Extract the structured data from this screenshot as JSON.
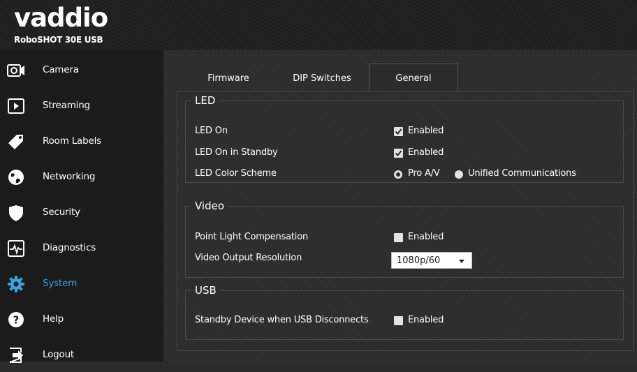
{
  "header": {
    "logo_text": "vaddio",
    "model": "RoboSHOT 30E USB"
  },
  "sidebar": {
    "items": [
      {
        "label": "Camera",
        "icon": "camera-icon"
      },
      {
        "label": "Streaming",
        "icon": "play-icon"
      },
      {
        "label": "Room Labels",
        "icon": "tag-icon"
      },
      {
        "label": "Networking",
        "icon": "globe-icon"
      },
      {
        "label": "Security",
        "icon": "shield-icon"
      },
      {
        "label": "Diagnostics",
        "icon": "pulse-icon"
      },
      {
        "label": "System",
        "icon": "gear-icon",
        "active": true
      },
      {
        "label": "Help",
        "icon": "help-icon"
      },
      {
        "label": "Logout",
        "icon": "logout-icon"
      }
    ],
    "active_color": "#3aa2dc"
  },
  "tabs": [
    {
      "label": "Firmware"
    },
    {
      "label": "DIP Switches"
    },
    {
      "label": "General",
      "active": true
    }
  ],
  "led": {
    "legend": "LED",
    "led_on": {
      "label": "LED On",
      "option": "Enabled",
      "checked": true
    },
    "led_standby": {
      "label": "LED On in Standby",
      "option": "Enabled",
      "checked": true
    },
    "color_scheme": {
      "label": "LED Color Scheme",
      "options": [
        "Pro A/V",
        "Unified Communications"
      ],
      "selected": "Pro A/V"
    }
  },
  "video": {
    "legend": "Video",
    "point_light": {
      "label": "Point Light Compensation",
      "option": "Enabled",
      "checked": false
    },
    "resolution": {
      "label": "Video Output Resolution",
      "value": "1080p/60"
    }
  },
  "usb": {
    "legend": "USB",
    "standby": {
      "label": "Standby Device when USB Disconnects",
      "option": "Enabled",
      "checked": false
    }
  }
}
